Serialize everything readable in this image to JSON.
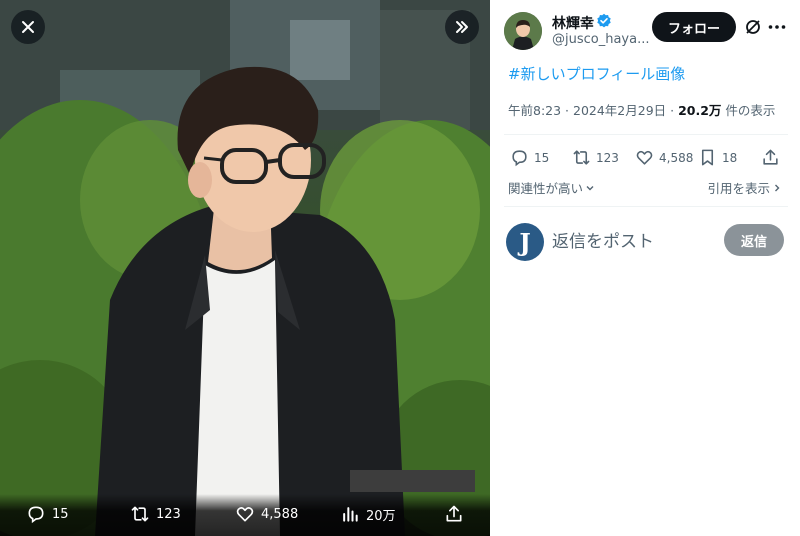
{
  "colors": {
    "accent": "#1d9bf0",
    "follow_bg": "#0f1419",
    "reply_btn_disabled": "#8b9399",
    "muted_text": "#536471"
  },
  "media": {
    "close_icon": "close-icon",
    "expand_icon": "double-chevron-right-icon",
    "actions": {
      "replies": "15",
      "reposts": "123",
      "likes": "4,588",
      "views": "20万"
    }
  },
  "author": {
    "name": "林輝幸",
    "handle": "@jusco_haya...",
    "verified": true
  },
  "header": {
    "follow_label": "フォロー"
  },
  "post": {
    "text": "#新しいプロフィール画像",
    "time": "午前8:23",
    "date": "2024年2月29日",
    "views": "20.2万",
    "views_suffix": "件の表示",
    "sep": " · "
  },
  "actions": {
    "replies": "15",
    "reposts": "123",
    "likes": "4,588",
    "bookmarks": "18"
  },
  "sort": {
    "relevance_label": "関連性が高い",
    "quotes_label": "引用を表示"
  },
  "reply": {
    "avatar_letter": "J",
    "placeholder": "返信をポスト",
    "button_label": "返信"
  }
}
